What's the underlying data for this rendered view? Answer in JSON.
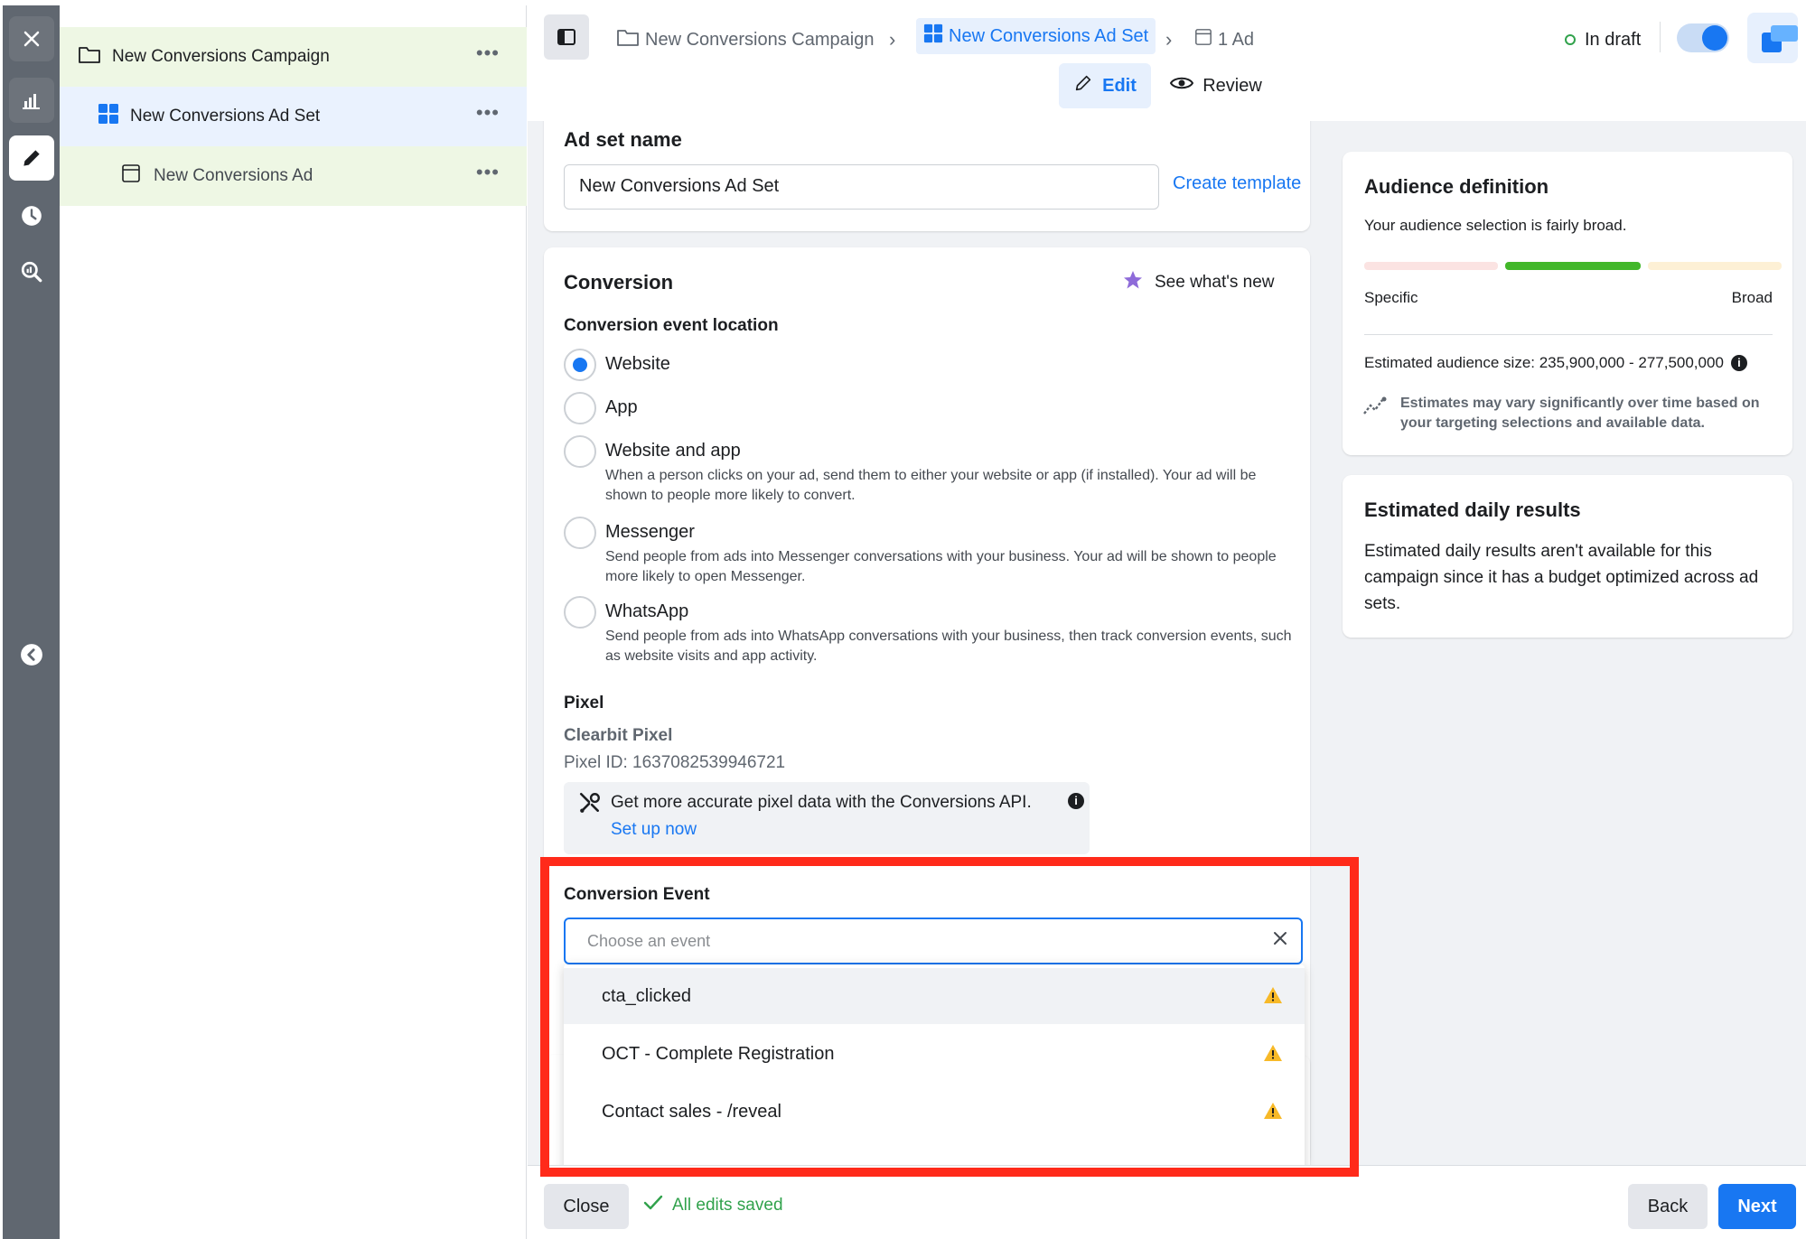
{
  "rail": {
    "icons": [
      "close-icon",
      "chart-icon",
      "pencil-icon",
      "clock-icon",
      "search-chart-icon",
      "collapse-icon"
    ]
  },
  "tree": {
    "items": [
      {
        "label": "New Conversions Campaign",
        "icon": "folder-icon"
      },
      {
        "label": "New Conversions Ad Set",
        "icon": "grid-icon"
      },
      {
        "label": "New Conversions Ad",
        "icon": "ad-icon"
      }
    ],
    "more": "•••"
  },
  "header": {
    "breadcrumb": {
      "campaign": "New Conversions Campaign",
      "adset": "New Conversions Ad Set",
      "ad": "1 Ad"
    },
    "status": "In draft",
    "edit_label": "Edit",
    "review_label": "Review"
  },
  "adset": {
    "name_label": "Ad set name",
    "name_value": "New Conversions Ad Set",
    "create_template": "Create template"
  },
  "conversion": {
    "title": "Conversion",
    "whats_new": "See what's new",
    "location_label": "Conversion event location",
    "options": [
      {
        "label": "Website",
        "desc": "",
        "selected": true
      },
      {
        "label": "App",
        "desc": "",
        "selected": false
      },
      {
        "label": "Website and app",
        "desc": "When a person clicks on your ad, send them to either your website or app (if installed). Your ad will be shown to people more likely to convert.",
        "selected": false
      },
      {
        "label": "Messenger",
        "desc": "Send people from ads into Messenger conversations with your business. Your ad will be shown to people more likely to open Messenger.",
        "selected": false
      },
      {
        "label": "WhatsApp",
        "desc": "Send people from ads into WhatsApp conversations with your business, then track conversion events, such as website visits and app activity.",
        "selected": false
      }
    ],
    "pixel_label": "Pixel",
    "pixel_name": "Clearbit Pixel",
    "pixel_id": "Pixel ID: 1637082539946721",
    "capi_text": "Get more accurate pixel data with the Conversions API.",
    "setup_link": "Set up now",
    "event_label": "Conversion Event",
    "event_placeholder": "Choose an event",
    "events": [
      "cta_clicked",
      "OCT - Complete Registration",
      "Contact sales - /reveal"
    ]
  },
  "audience": {
    "title": "Audience definition",
    "summary": "Your audience selection is fairly broad.",
    "specific": "Specific",
    "broad": "Broad",
    "size": "Estimated audience size: 235,900,000 - 277,500,000",
    "note": "Estimates may vary significantly over time based on your targeting selections and available data."
  },
  "daily": {
    "title": "Estimated daily results",
    "text": "Estimated daily results aren't available for this campaign since it has a budget optimized across ad sets."
  },
  "footer": {
    "close": "Close",
    "saved": "All edits saved",
    "back": "Back",
    "next": "Next"
  },
  "colors": {
    "accent": "#1877f2",
    "highlight": "#ff2a1a",
    "saved": "#31a24c",
    "warning": "#f7b928",
    "rail": "#606770"
  }
}
